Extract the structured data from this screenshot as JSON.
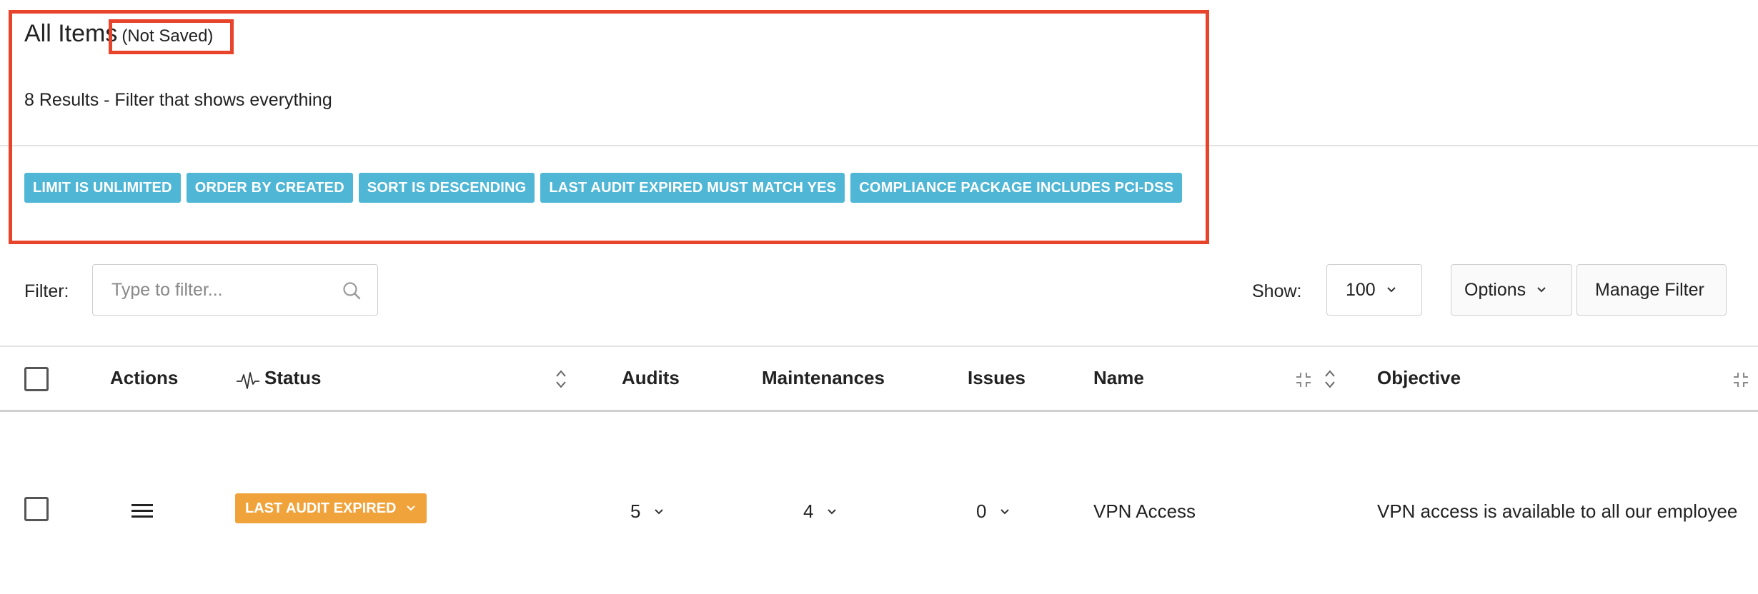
{
  "header": {
    "title": "All Items",
    "title_status": "(Not Saved)",
    "results": "8 Results - Filter that shows everything",
    "badges": [
      "LIMIT IS UNLIMITED",
      "ORDER BY CREATED",
      "SORT IS DESCENDING",
      "LAST AUDIT EXPIRED MUST MATCH YES",
      "COMPLIANCE PACKAGE INCLUDES PCI-DSS"
    ]
  },
  "toolbar": {
    "filter_label": "Filter:",
    "filter_placeholder": "Type to filter...",
    "show_label": "Show:",
    "show_value": "100",
    "options_label": "Options",
    "manage_filter_label": "Manage Filter"
  },
  "table": {
    "columns": {
      "actions": "Actions",
      "status": "Status",
      "audits": "Audits",
      "maintenances": "Maintenances",
      "issues": "Issues",
      "name": "Name",
      "objective": "Objective"
    },
    "rows": [
      {
        "status": "LAST AUDIT EXPIRED",
        "audits": "5",
        "maintenances": "4",
        "issues": "0",
        "name": "VPN Access",
        "objective": "VPN access is available to all our employee"
      }
    ]
  },
  "colors": {
    "badge": "#4fb6d6",
    "status_badge": "#f0a33a",
    "annotation": "#e8432b"
  },
  "icons": {
    "search": "search-icon",
    "chevron": "chevron-down-icon",
    "sort": "sort-icon",
    "collapse": "collapse-icon",
    "activity": "activity-icon",
    "menu": "menu-icon"
  }
}
